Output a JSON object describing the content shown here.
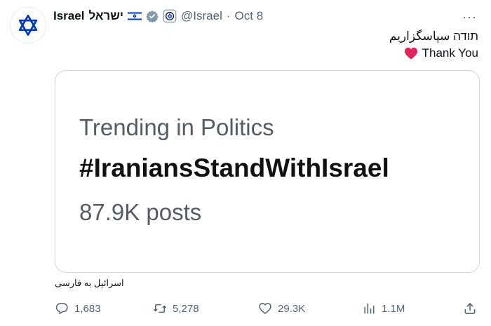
{
  "tweet": {
    "author_name": "Israel",
    "author_name_hebrew": "ישראל",
    "handle": "@Israel",
    "separator": "·",
    "date": "Oct 8",
    "more_label": "···",
    "text_line1": "תודה سپاسگزاریم",
    "text_line2": "Thank You",
    "translate_label": "اسرائیل به فارسی"
  },
  "card": {
    "label": "Trending in Politics",
    "hashtag": "#IraniansStandWithIsrael",
    "post_count": "87.9K posts"
  },
  "actions": {
    "replies": "1,683",
    "reposts": "5,278",
    "likes": "29.3K",
    "views": "1.1M"
  },
  "colors": {
    "muted": "#536471",
    "verified_gray": "#829aab",
    "flag_blue": "#0038b8",
    "heart": "#e0245e"
  },
  "icons": [
    "star-of-david-icon",
    "israel-flag-icon",
    "verified-badge-icon",
    "affiliate-badge-icon",
    "more-icon",
    "heart-icon",
    "reply-icon",
    "repost-icon",
    "like-icon",
    "views-icon",
    "share-icon"
  ]
}
